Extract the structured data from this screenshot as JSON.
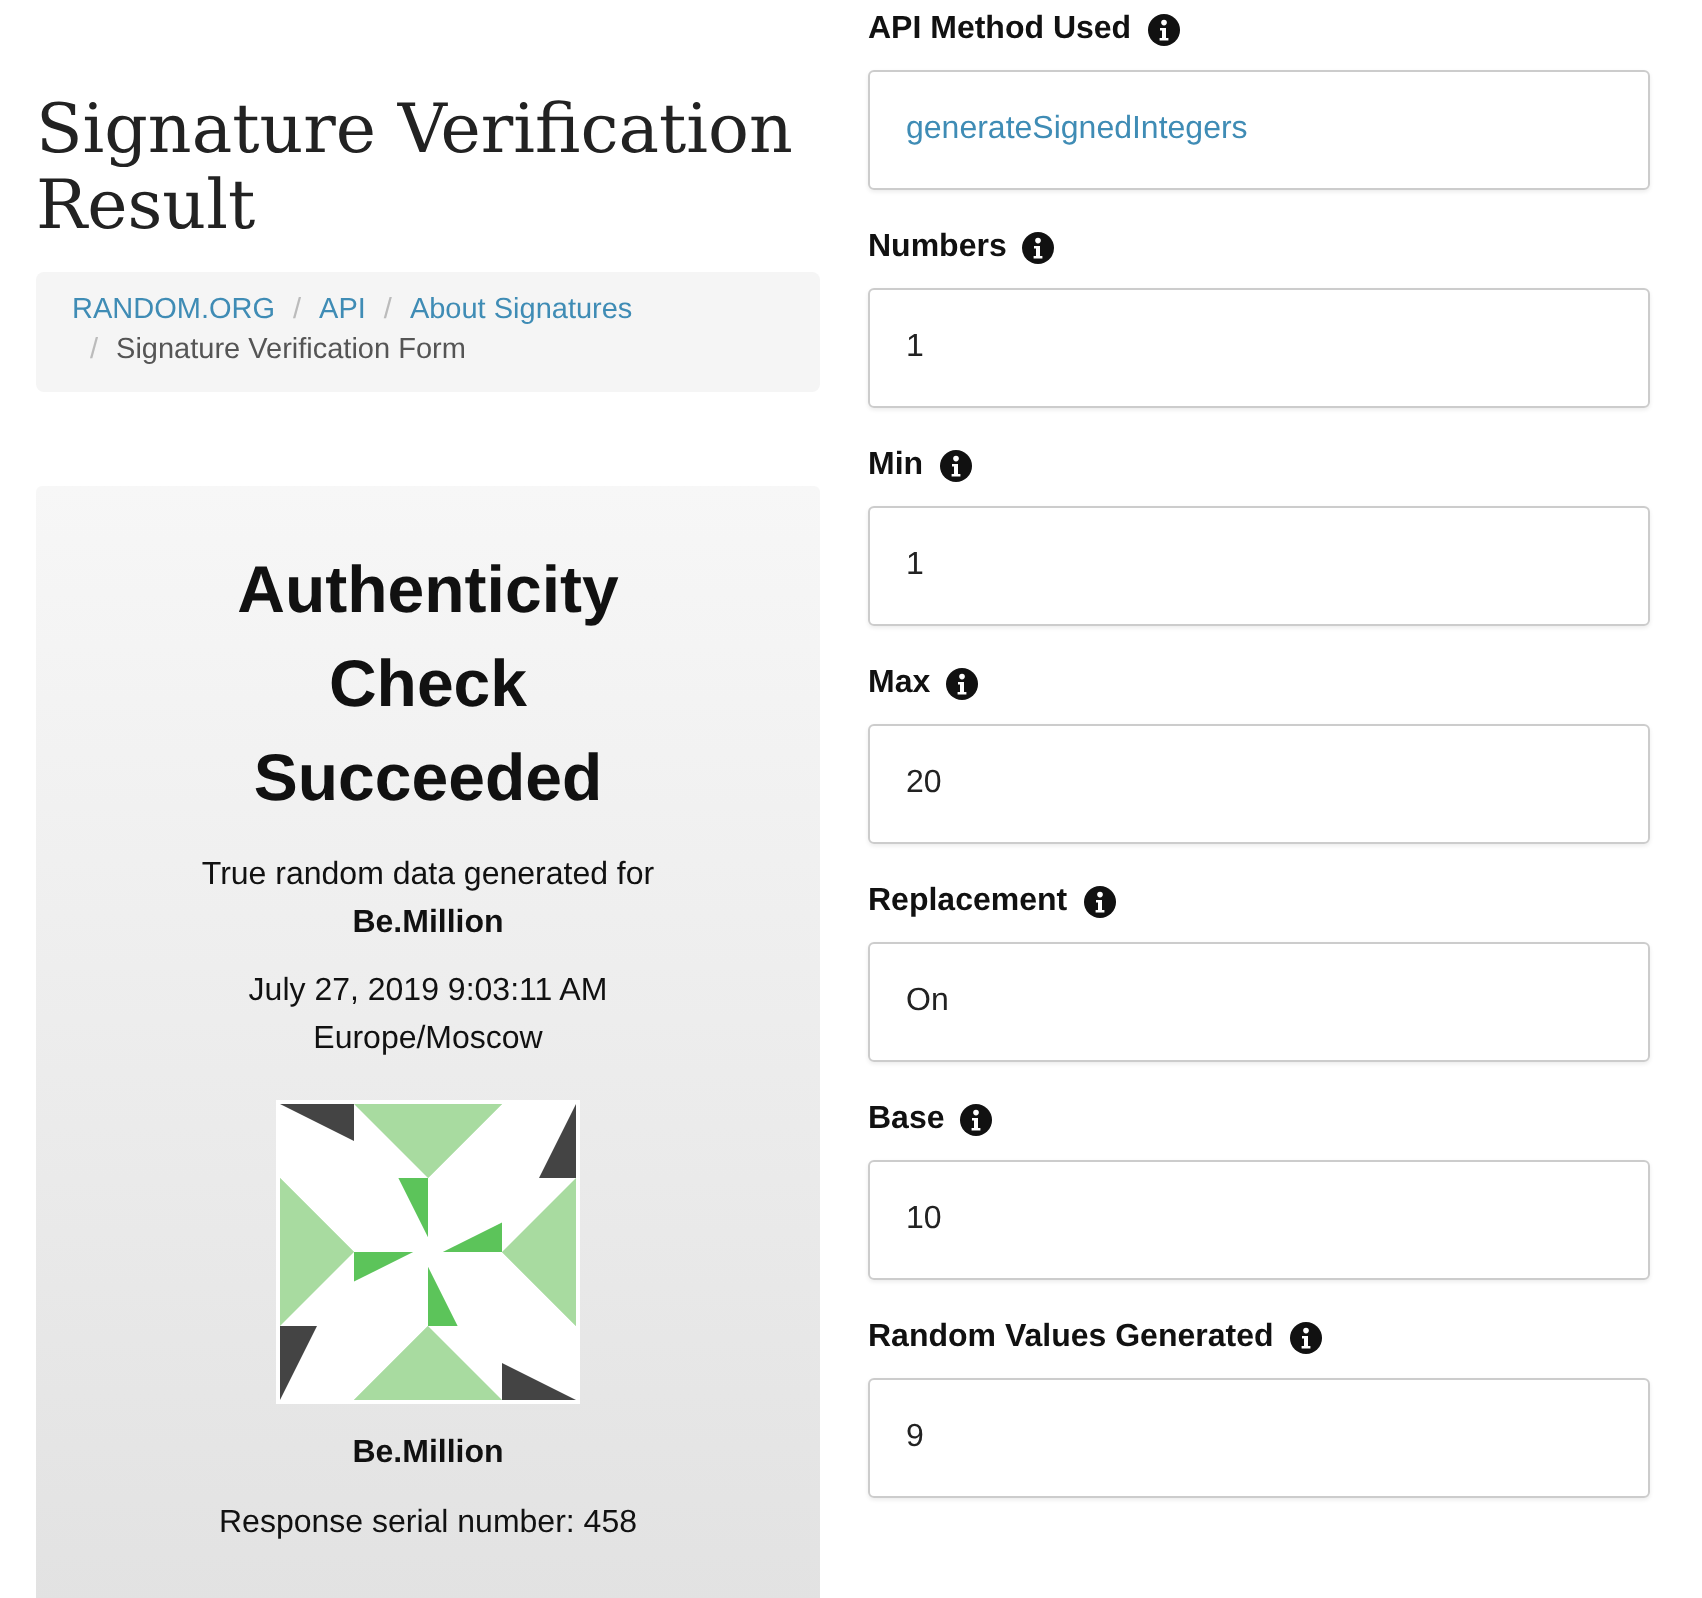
{
  "page": {
    "title": "Signature Verification Result"
  },
  "breadcrumb": [
    {
      "label": "RANDOM.ORG",
      "kind": "link"
    },
    {
      "label": "API",
      "kind": "link",
      "separator": "/"
    },
    {
      "label": "About Signatures",
      "kind": "link",
      "separator": "/"
    },
    {
      "label": "Signature Verification Form",
      "kind": "current",
      "separator": "/"
    }
  ],
  "result": {
    "heading": "Authenticity Check Succeeded",
    "generated_for_label": "True random data generated for",
    "user": "Be.Million",
    "timestamp": "July 27, 2019 9:03:11 AM",
    "timezone": "Europe/Moscow",
    "identicon_user": "Be.Million",
    "serial": "Response serial number: 458"
  },
  "fields": [
    {
      "label": "API Method Used",
      "value": "generateSignedIntegers",
      "kind": "link"
    },
    {
      "label": "Numbers",
      "value": "1",
      "kind": "text"
    },
    {
      "label": "Min",
      "value": "1",
      "kind": "text"
    },
    {
      "label": "Max",
      "value": "20",
      "kind": "text"
    },
    {
      "label": "Replacement",
      "value": "On",
      "kind": "text"
    },
    {
      "label": "Base",
      "value": "10",
      "kind": "text"
    },
    {
      "label": "Random Values Generated",
      "value": "9",
      "kind": "text"
    }
  ]
}
